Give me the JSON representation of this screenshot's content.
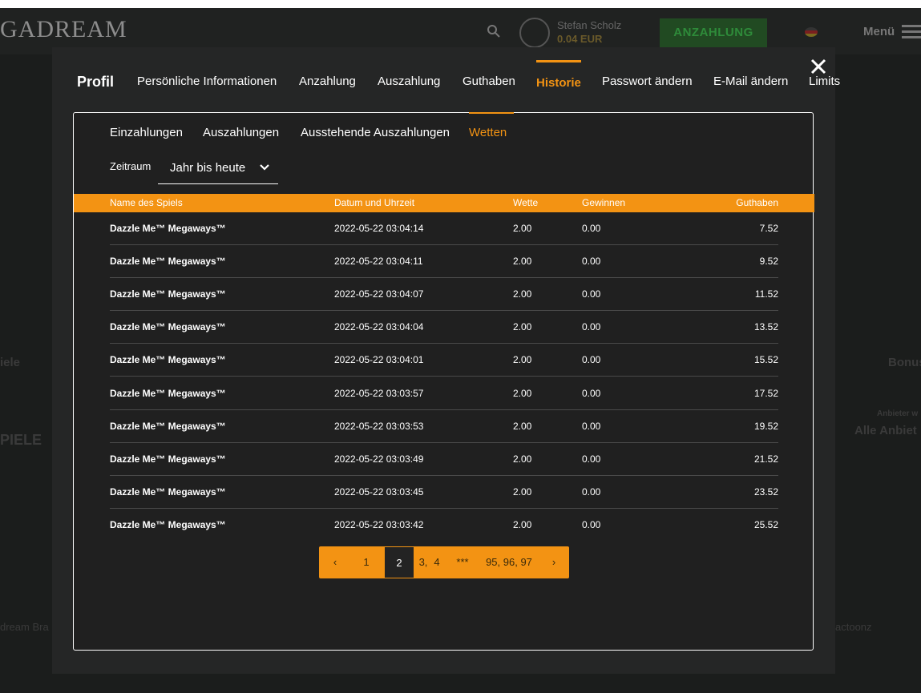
{
  "background": {
    "logo": "GADREAM",
    "user_name": "Stefan Scholz",
    "user_balance": "0.04 EUR",
    "deposit_button": "ANZAHLUNG",
    "menu_label": "Menü",
    "side_text_left": "iele",
    "side_text_left2": "PIELE",
    "side_text_right": "Bonus",
    "provider_label": "Anbieter w",
    "provider_value": "Alle Anbiet",
    "game_left": "dream Bra",
    "game_right": "actoonz"
  },
  "modal": {
    "tabs": [
      {
        "label": "Profil"
      },
      {
        "label": "Persönliche Informationen"
      },
      {
        "label": "Anzahlung"
      },
      {
        "label": "Auszahlung"
      },
      {
        "label": "Guthaben"
      },
      {
        "label": "Historie"
      },
      {
        "label": "Passwort ändern"
      },
      {
        "label": "E-Mail ändern"
      },
      {
        "label": "Limits"
      }
    ],
    "subtabs": [
      {
        "label": "Einzahlungen"
      },
      {
        "label": "Auszahlungen"
      },
      {
        "label": "Ausstehende Auszahlungen"
      },
      {
        "label": "Wetten"
      }
    ],
    "period_label": "Zeitraum",
    "period_value": "Jahr bis heute",
    "columns": [
      "Name des Spiels",
      "Datum und Uhrzeit",
      "Wette",
      "Gewinnen",
      "Guthaben"
    ],
    "rows": [
      {
        "game": "Dazzle Me™ Megaways™",
        "date": "2022-05-22 03:04:14",
        "bet": "2.00",
        "win": "0.00",
        "balance": "7.52"
      },
      {
        "game": "Dazzle Me™ Megaways™",
        "date": "2022-05-22 03:04:11",
        "bet": "2.00",
        "win": "0.00",
        "balance": "9.52"
      },
      {
        "game": "Dazzle Me™ Megaways™",
        "date": "2022-05-22 03:04:07",
        "bet": "2.00",
        "win": "0.00",
        "balance": "11.52"
      },
      {
        "game": "Dazzle Me™ Megaways™",
        "date": "2022-05-22 03:04:04",
        "bet": "2.00",
        "win": "0.00",
        "balance": "13.52"
      },
      {
        "game": "Dazzle Me™ Megaways™",
        "date": "2022-05-22 03:04:01",
        "bet": "2.00",
        "win": "0.00",
        "balance": "15.52"
      },
      {
        "game": "Dazzle Me™ Megaways™",
        "date": "2022-05-22 03:03:57",
        "bet": "2.00",
        "win": "0.00",
        "balance": "17.52"
      },
      {
        "game": "Dazzle Me™ Megaways™",
        "date": "2022-05-22 03:03:53",
        "bet": "2.00",
        "win": "0.00",
        "balance": "19.52"
      },
      {
        "game": "Dazzle Me™ Megaways™",
        "date": "2022-05-22 03:03:49",
        "bet": "2.00",
        "win": "0.00",
        "balance": "21.52"
      },
      {
        "game": "Dazzle Me™ Megaways™",
        "date": "2022-05-22 03:03:45",
        "bet": "2.00",
        "win": "0.00",
        "balance": "23.52"
      },
      {
        "game": "Dazzle Me™ Megaways™",
        "date": "2022-05-22 03:03:42",
        "bet": "2.00",
        "win": "0.00",
        "balance": "25.52"
      }
    ],
    "pagination": {
      "prev": "‹",
      "pages": [
        "1",
        "2",
        "3,",
        "4",
        "***",
        "95, 96, 97"
      ],
      "next": "›"
    },
    "close_icon": "close-icon",
    "accent_color": "#f39313"
  }
}
